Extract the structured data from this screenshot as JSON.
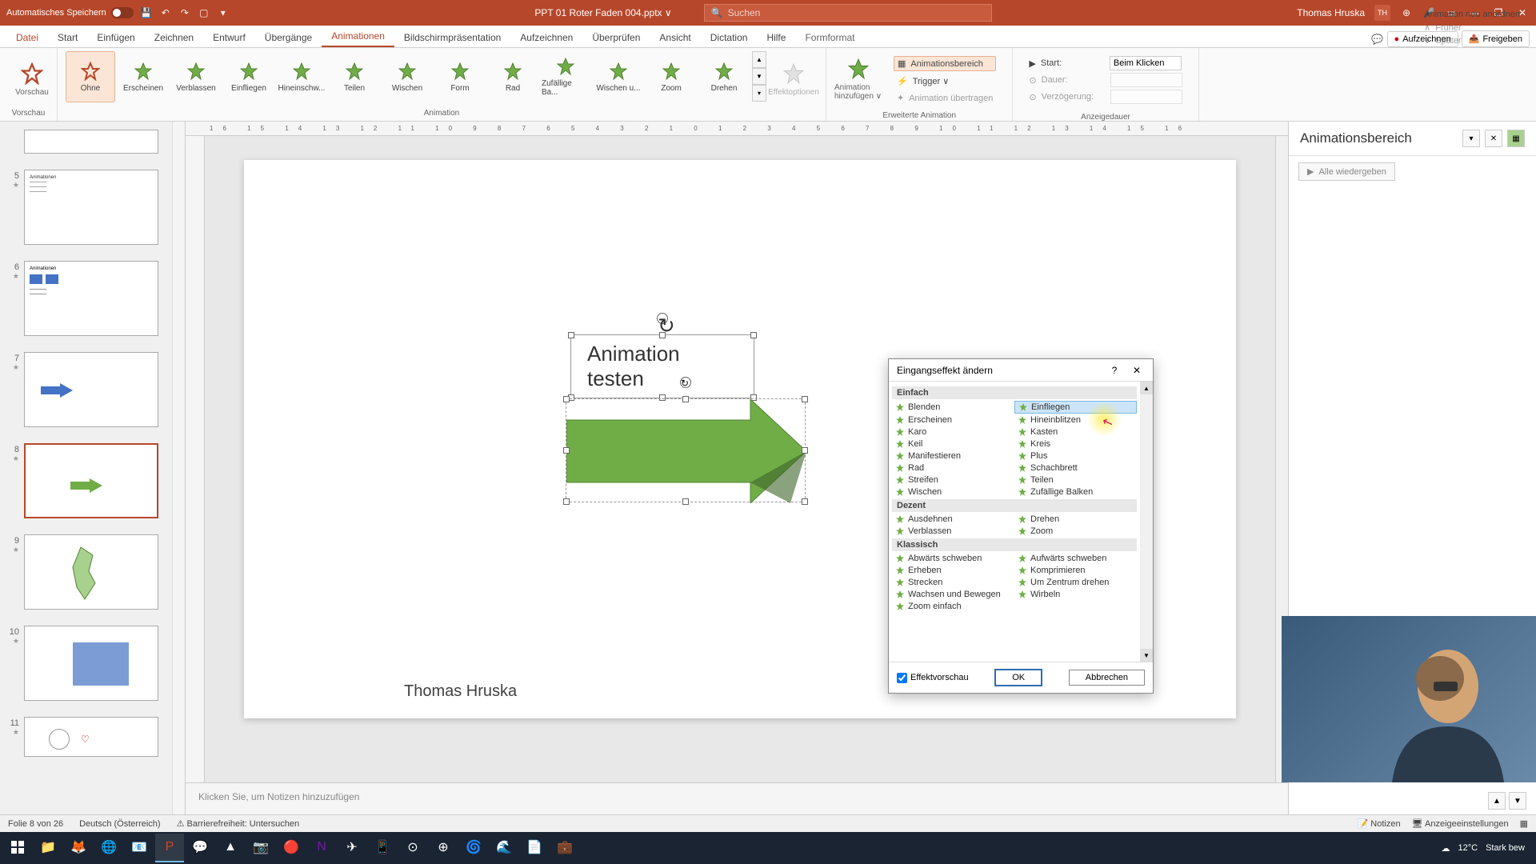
{
  "titlebar": {
    "autosave": "Automatisches Speichern",
    "doc": "PPT 01 Roter Faden 004.pptx ∨",
    "search_placeholder": "Suchen",
    "user": "Thomas Hruska",
    "user_initials": "TH"
  },
  "menu": {
    "file": "Datei",
    "tabs": [
      "Start",
      "Einfügen",
      "Zeichnen",
      "Entwurf",
      "Übergänge",
      "Animationen",
      "Bildschirmpräsentation",
      "Aufzeichnen",
      "Überprüfen",
      "Ansicht",
      "Dictation",
      "Hilfe",
      "Formformat"
    ],
    "active": "Animationen",
    "record": "Aufzeichnen",
    "share": "Freigeben"
  },
  "ribbon": {
    "preview": "Vorschau",
    "anims": [
      "Ohne",
      "Erscheinen",
      "Verblassen",
      "Einfliegen",
      "Hineinschw...",
      "Teilen",
      "Wischen",
      "Form",
      "Rad",
      "Zufällige Ba...",
      "Wischen u...",
      "Zoom",
      "Drehen"
    ],
    "effect_options": "Effektoptionen",
    "add_anim": "Animation hinzufügen ∨",
    "ext": {
      "pane": "Animationsbereich",
      "trigger": "Trigger ∨",
      "painter": "Animation übertragen"
    },
    "timing": {
      "start_label": "Start:",
      "start_value": "Beim Klicken",
      "duration_label": "Dauer:",
      "duration_value": "",
      "delay_label": "Verzögerung:",
      "delay_value": "",
      "reorder": "Animation neu anordnen",
      "earlier": "Früher",
      "later": "Später"
    },
    "groups": {
      "preview": "Vorschau",
      "animation": "Animation",
      "ext": "Erweiterte Animation",
      "timing": "Anzeigedauer"
    }
  },
  "thumbnails": {
    "visible": [
      {
        "n": "",
        "active": false
      },
      {
        "n": "5",
        "active": false,
        "star": true
      },
      {
        "n": "6",
        "active": false,
        "star": true
      },
      {
        "n": "7",
        "active": false,
        "star": true
      },
      {
        "n": "8",
        "active": true,
        "star": true
      },
      {
        "n": "9",
        "active": false,
        "star": true
      },
      {
        "n": "10",
        "active": false,
        "star": true
      },
      {
        "n": "11",
        "active": false,
        "star": true
      }
    ]
  },
  "slide": {
    "textbox": "Animation testen",
    "footer": "Thomas Hruska"
  },
  "anim_pane": {
    "title": "Animationsbereich",
    "play_all": "Alle wiedergeben"
  },
  "notes": {
    "placeholder": "Klicken Sie, um Notizen hinzuzufügen"
  },
  "status": {
    "slide": "Folie 8 von 26",
    "lang": "Deutsch (Österreich)",
    "access": "Barrierefreiheit: Untersuchen",
    "notes": "Notizen",
    "display": "Anzeigeeinstellungen"
  },
  "dialog": {
    "title": "Eingangseffekt ändern",
    "cats": {
      "einfach": "Einfach",
      "dezent": "Dezent",
      "klassisch": "Klassisch"
    },
    "einfach": [
      [
        "Blenden",
        "Einfliegen"
      ],
      [
        "Erscheinen",
        "Hineinblitzen"
      ],
      [
        "Karo",
        "Kasten"
      ],
      [
        "Keil",
        "Kreis"
      ],
      [
        "Manifestieren",
        "Plus"
      ],
      [
        "Rad",
        "Schachbrett"
      ],
      [
        "Streifen",
        "Teilen"
      ],
      [
        "Wischen",
        "Zufällige Balken"
      ]
    ],
    "dezent": [
      [
        "Ausdehnen",
        "Drehen"
      ],
      [
        "Verblassen",
        "Zoom"
      ]
    ],
    "klassisch": [
      [
        "Abwärts schweben",
        "Aufwärts schweben"
      ],
      [
        "Erheben",
        "Komprimieren"
      ],
      [
        "Strecken",
        "Um Zentrum drehen"
      ],
      [
        "Wachsen und Bewegen",
        "Wirbeln"
      ],
      [
        "Zoom einfach",
        ""
      ]
    ],
    "selected": "Einfliegen",
    "preview_check": "Effektvorschau",
    "ok": "OK",
    "cancel": "Abbrechen"
  },
  "taskbar": {
    "weather_temp": "12°C",
    "weather_text": "Stark bew"
  }
}
